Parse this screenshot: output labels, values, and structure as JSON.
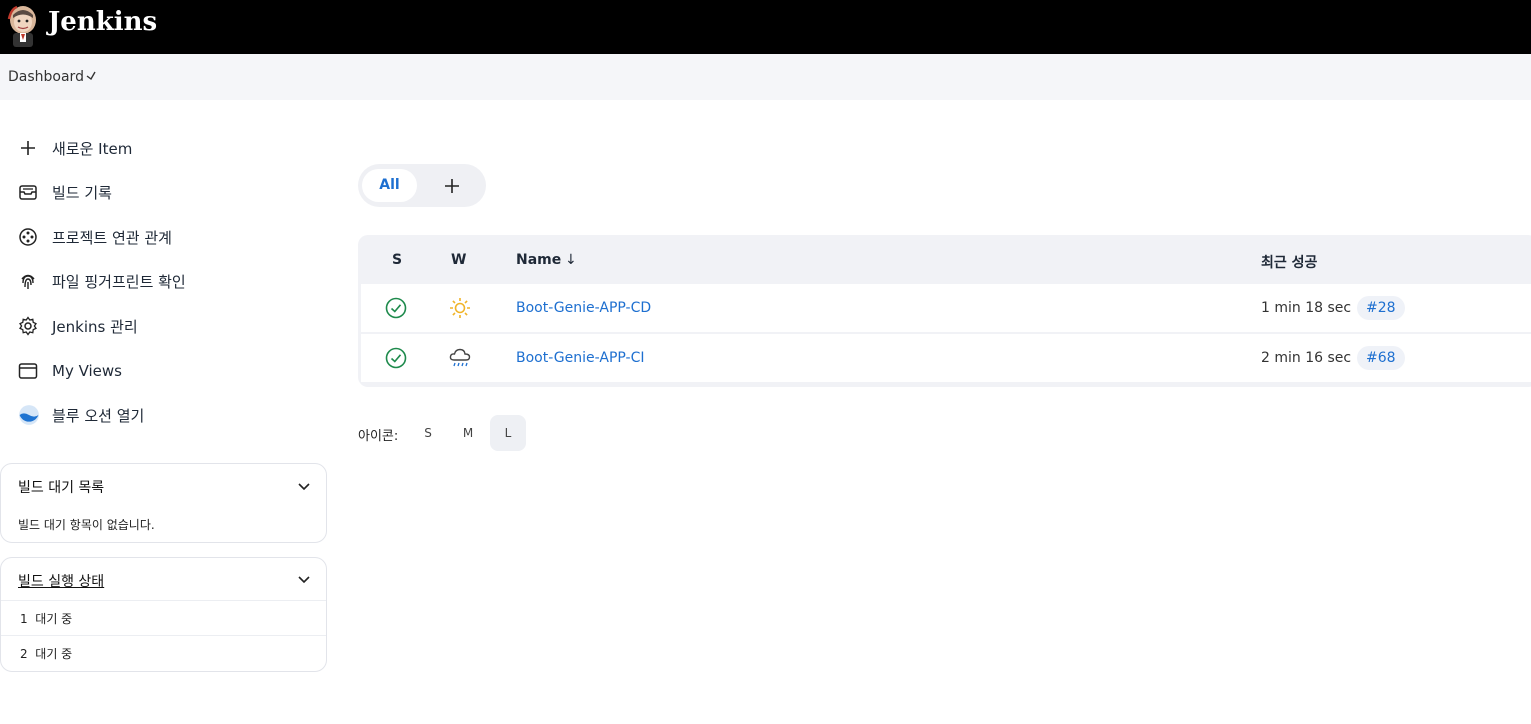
{
  "header": {
    "title": "Jenkins"
  },
  "breadcrumb": {
    "items": [
      "Dashboard"
    ]
  },
  "tasks": [
    {
      "label": "새로운 Item",
      "icon": "plus-icon"
    },
    {
      "label": "빌드 기록",
      "icon": "build-history-icon"
    },
    {
      "label": "프로젝트 연관 관계",
      "icon": "relationship-icon"
    },
    {
      "label": "파일 핑거프린트 확인",
      "icon": "fingerprint-icon"
    },
    {
      "label": "Jenkins 관리",
      "icon": "gear-icon"
    },
    {
      "label": "My Views",
      "icon": "window-icon"
    },
    {
      "label": "블루 오션 열기",
      "icon": "blue-ocean-icon"
    }
  ],
  "build_queue": {
    "title": "빌드 대기 목록",
    "empty_text": "빌드 대기 항목이 없습니다."
  },
  "executors": {
    "title": "빌드 실행 상태",
    "rows": [
      {
        "num": "1",
        "status": "대기 중"
      },
      {
        "num": "2",
        "status": "대기 중"
      }
    ]
  },
  "view_tabs": {
    "all_label": "All"
  },
  "table": {
    "headers": {
      "s": "S",
      "w": "W",
      "name": "Name",
      "sort_arrow": "↓",
      "last_success": "최근 성공"
    },
    "rows": [
      {
        "status_icon": "success-check-icon",
        "weather_icon": "sunny-icon",
        "name": "Boot-Genie-APP-CD",
        "duration": "1 min 18 sec",
        "build": "#28"
      },
      {
        "status_icon": "success-check-icon",
        "weather_icon": "rain-icon",
        "name": "Boot-Genie-APP-CI",
        "duration": "2 min 16 sec",
        "build": "#68"
      }
    ]
  },
  "icon_size": {
    "label": "아이콘:",
    "options": [
      "S",
      "M",
      "L"
    ],
    "selected": "L"
  },
  "colors": {
    "header_bg": "#000000",
    "link": "#1d6fd0",
    "success": "#1e8a4c",
    "sun": "#f0b429",
    "breadcrumb_bg": "#f5f6f9"
  }
}
